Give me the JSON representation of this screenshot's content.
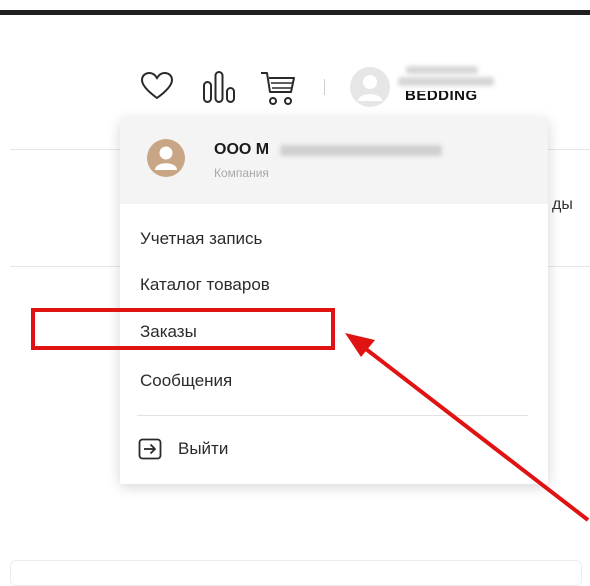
{
  "header": {
    "icons": [
      "heart-icon",
      "compare-icon",
      "cart-icon",
      "user-avatar-icon"
    ],
    "account_brand": "BEDDING"
  },
  "background": {
    "right_text": "ды"
  },
  "dropdown": {
    "company_name": "ООО М",
    "company_sub": "Компания",
    "menu": [
      {
        "label": "Учетная запись"
      },
      {
        "label": "Каталог товаров"
      },
      {
        "label": "Заказы"
      },
      {
        "label": "Сообщения"
      }
    ],
    "logout_label": "Выйти"
  },
  "annotation": {
    "color": "#e01212",
    "highlighted_item": "Заказы"
  },
  "colors": {
    "company_avatar": "#c7a585",
    "account_avatar": "#e6e6e6",
    "top_bar": "#1f1f1f"
  }
}
